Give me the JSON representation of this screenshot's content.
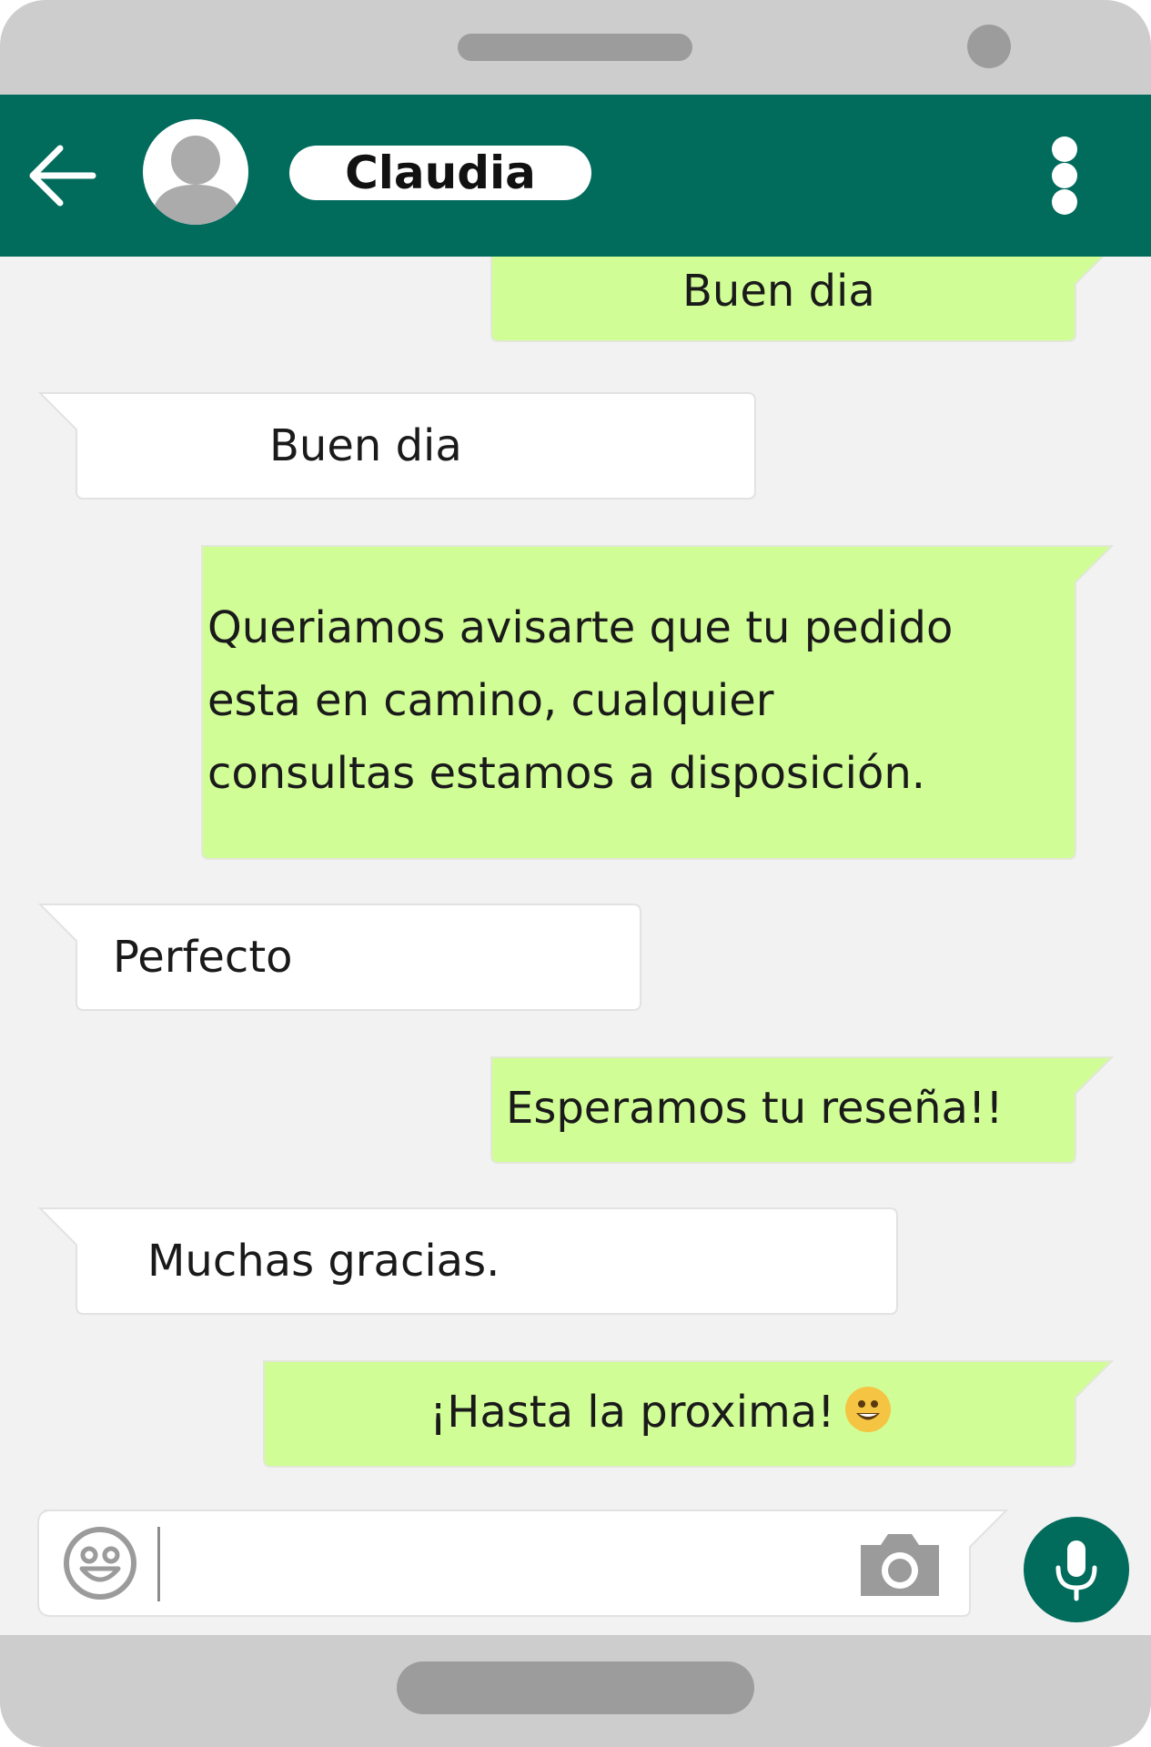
{
  "contact": {
    "name": "Claudia"
  },
  "messages": [
    {
      "direction": "sent",
      "text": "Buen dia"
    },
    {
      "direction": "received",
      "text": "Buen dia"
    },
    {
      "direction": "sent",
      "lines": [
        "Queriamos avisarte que tu pedido",
        "esta en camino, cualquier",
        "consultas estamos a disposición."
      ]
    },
    {
      "direction": "received",
      "text": "Perfecto"
    },
    {
      "direction": "sent",
      "text": "Esperamos tu reseña!!"
    },
    {
      "direction": "received",
      "text": "Muchas gracias."
    },
    {
      "direction": "sent",
      "text": "¡Hasta la proxima!",
      "emoji": "smiley-emoji"
    }
  ],
  "input": {
    "value": "",
    "placeholder": ""
  },
  "icons": {
    "back": "back-arrow-icon",
    "avatar": "person-icon",
    "menu": "more-vertical-icon",
    "emoji": "smiley-icon",
    "camera": "camera-icon",
    "mic": "microphone-icon"
  },
  "colors": {
    "header": "#016b5c",
    "sent_bubble": "#d1fd96",
    "received_bubble": "#ffffff",
    "chat_background": "#f2f2f2",
    "phone_frame": "#cdcdcd"
  }
}
